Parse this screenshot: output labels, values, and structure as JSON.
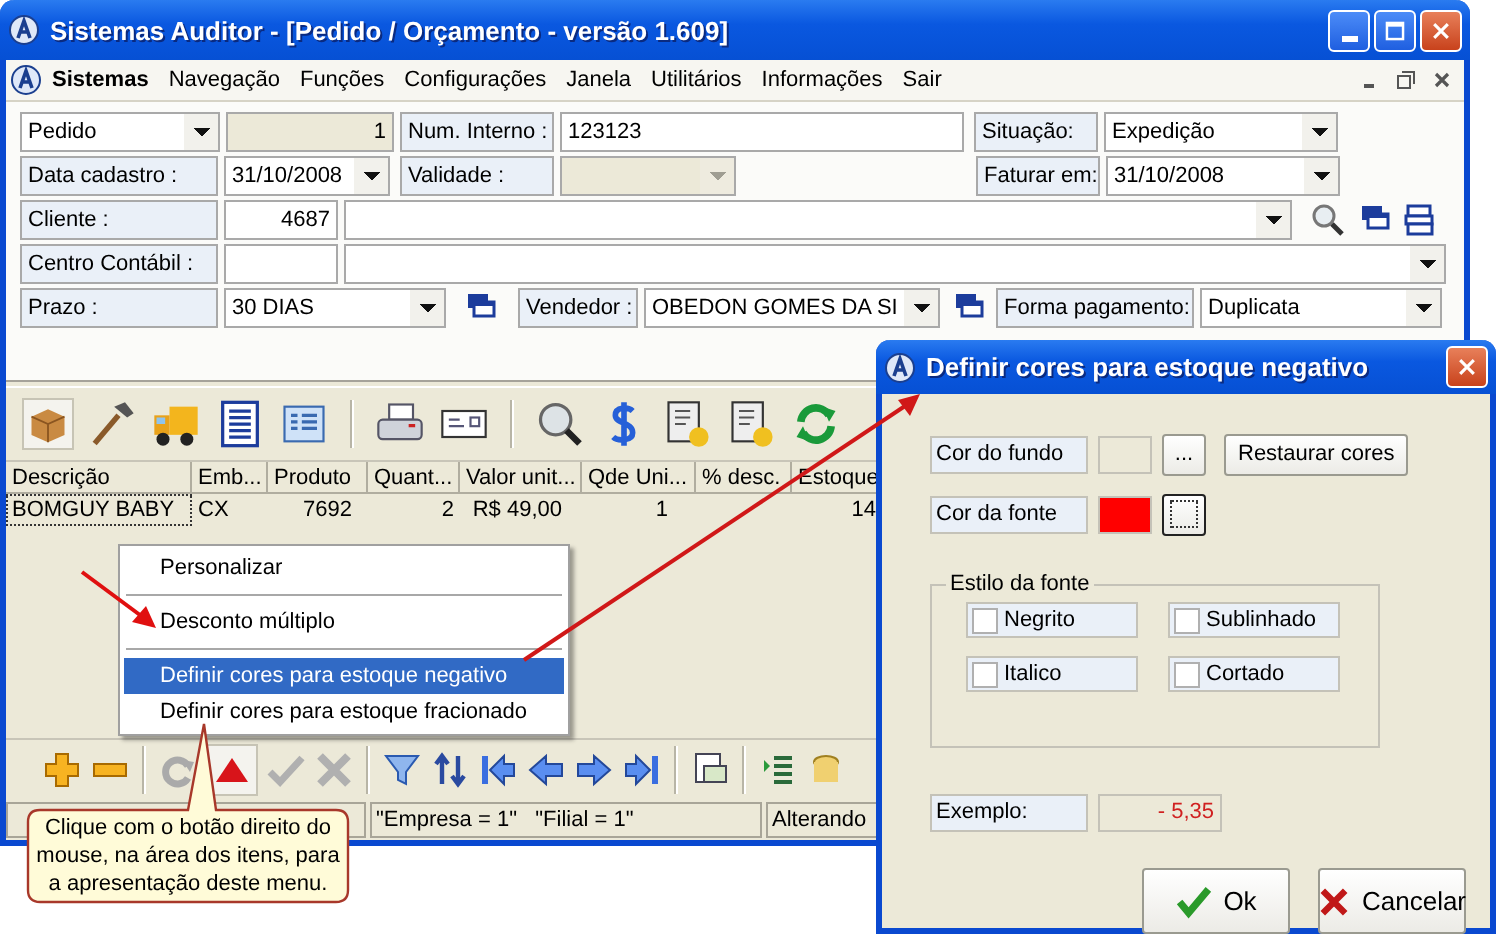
{
  "window": {
    "title": "Sistemas Auditor - [Pedido / Orçamento - versão 1.609]"
  },
  "menu": {
    "app": "Sistemas",
    "items": [
      "Navegação",
      "Funções",
      "Configurações",
      "Janela",
      "Utilitários",
      "Informações",
      "Sair"
    ]
  },
  "form": {
    "tipo": "Pedido",
    "numero": "1",
    "num_interno_label": "Num. Interno :",
    "num_interno": "123123",
    "situacao_label": "Situação:",
    "situacao": "Expedição",
    "data_label": "Data cadastro :",
    "data": "31/10/2008",
    "validade_label": "Validade :",
    "validade_disabled": true,
    "faturar_label": "Faturar em:",
    "faturar": "31/10/2008",
    "cliente_label": "Cliente :",
    "cliente_codigo": "4687",
    "centro_label": "Centro Contábil :",
    "prazo_label": "Prazo :",
    "prazo": "30 DIAS",
    "vendedor_label": "Vendedor :",
    "vendedor": "OBEDON GOMES DA SI",
    "forma_label": "Forma pagamento:",
    "forma": "Duplicata"
  },
  "table": {
    "columns": [
      "Descrição",
      "Emb...",
      "Produto",
      "Quant...",
      "Valor unit...",
      "Qde Uni...",
      "% desc.",
      "Estoque"
    ],
    "rows": [
      {
        "cells": [
          "BOMGUY BABY",
          "CX",
          "7692",
          "2",
          "R$ 49,00",
          "1",
          null,
          "14"
        ],
        "selected": true
      }
    ]
  },
  "context_menu": {
    "items": [
      {
        "kind": "item",
        "label": "Personalizar",
        "selected": false
      },
      {
        "kind": "separator"
      },
      {
        "kind": "item",
        "label": "Desconto múltiplo",
        "selected": false
      },
      {
        "kind": "separator"
      },
      {
        "kind": "item",
        "label": "Definir cores para estoque negativo",
        "selected": true
      },
      {
        "kind": "item",
        "label": "Definir cores para estoque fracionado",
        "selected": false
      }
    ]
  },
  "callout": {
    "text": "Clique com o botão direito do mouse, na área dos itens, para a apresentação deste menu."
  },
  "status_bar": [
    "\"Empresa = 1\"   \"Filial = 1\"",
    "Alterando"
  ],
  "dialog": {
    "title": "Definir cores para estoque negativo",
    "background_label": "Cor do fundo",
    "browse": "...",
    "restore": "Restaurar cores",
    "font_label": "Cor da fonte",
    "style_group": "Estilo da fonte",
    "styles": [
      {
        "label": "Negrito",
        "checked": false
      },
      {
        "label": "Sublinhado",
        "checked": false
      },
      {
        "label": "Italico",
        "checked": false
      },
      {
        "label": "Cortado",
        "checked": false
      }
    ],
    "example_label": "Exemplo:",
    "example": "- 5,35",
    "ok": "Ok",
    "cancel": "Cancelar"
  }
}
